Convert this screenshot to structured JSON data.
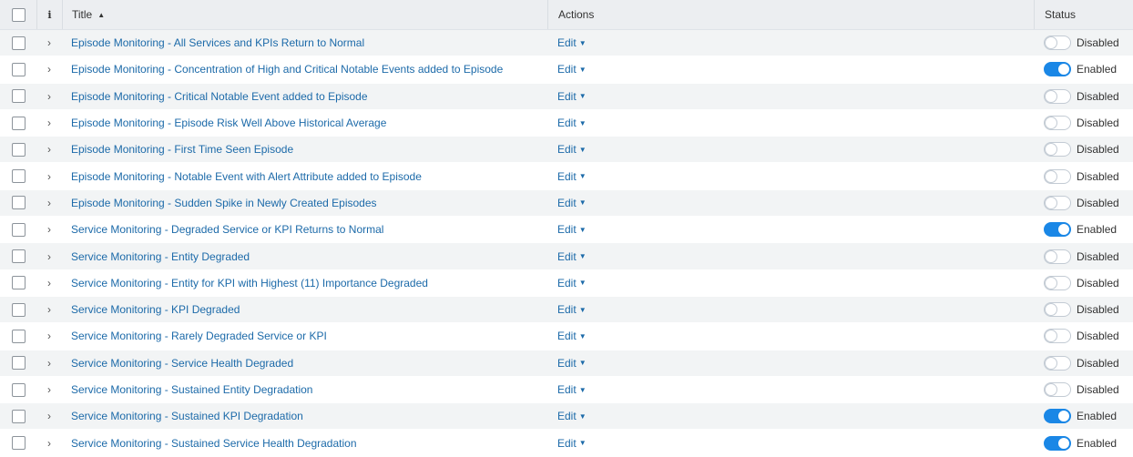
{
  "header": {
    "title": "Title",
    "actions": "Actions",
    "status": "Status",
    "sort_icon": "caret-up",
    "info_glyph": "i"
  },
  "edit_label": "Edit",
  "rows": [
    {
      "title": "Episode Monitoring - All Services and KPIs Return to Normal",
      "status": "Disabled",
      "enabled": false
    },
    {
      "title": "Episode Monitoring - Concentration of High and Critical Notable Events added to Episode",
      "status": "Enabled",
      "enabled": true
    },
    {
      "title": "Episode Monitoring - Critical Notable Event added to Episode",
      "status": "Disabled",
      "enabled": false
    },
    {
      "title": "Episode Monitoring - Episode Risk Well Above Historical Average",
      "status": "Disabled",
      "enabled": false
    },
    {
      "title": "Episode Monitoring - First Time Seen Episode",
      "status": "Disabled",
      "enabled": false
    },
    {
      "title": "Episode Monitoring - Notable Event with Alert Attribute added to Episode",
      "status": "Disabled",
      "enabled": false
    },
    {
      "title": "Episode Monitoring - Sudden Spike in Newly Created Episodes",
      "status": "Disabled",
      "enabled": false
    },
    {
      "title": "Service Monitoring - Degraded Service or KPI Returns to Normal",
      "status": "Enabled",
      "enabled": true
    },
    {
      "title": "Service Monitoring - Entity Degraded",
      "status": "Disabled",
      "enabled": false
    },
    {
      "title": "Service Monitoring - Entity for KPI with Highest (11) Importance Degraded",
      "status": "Disabled",
      "enabled": false
    },
    {
      "title": "Service Monitoring - KPI Degraded",
      "status": "Disabled",
      "enabled": false
    },
    {
      "title": "Service Monitoring - Rarely Degraded Service or KPI",
      "status": "Disabled",
      "enabled": false
    },
    {
      "title": "Service Monitoring - Service Health Degraded",
      "status": "Disabled",
      "enabled": false
    },
    {
      "title": "Service Monitoring - Sustained Entity Degradation",
      "status": "Disabled",
      "enabled": false
    },
    {
      "title": "Service Monitoring - Sustained KPI Degradation",
      "status": "Enabled",
      "enabled": true
    },
    {
      "title": "Service Monitoring - Sustained Service Health Degradation",
      "status": "Enabled",
      "enabled": true
    }
  ]
}
